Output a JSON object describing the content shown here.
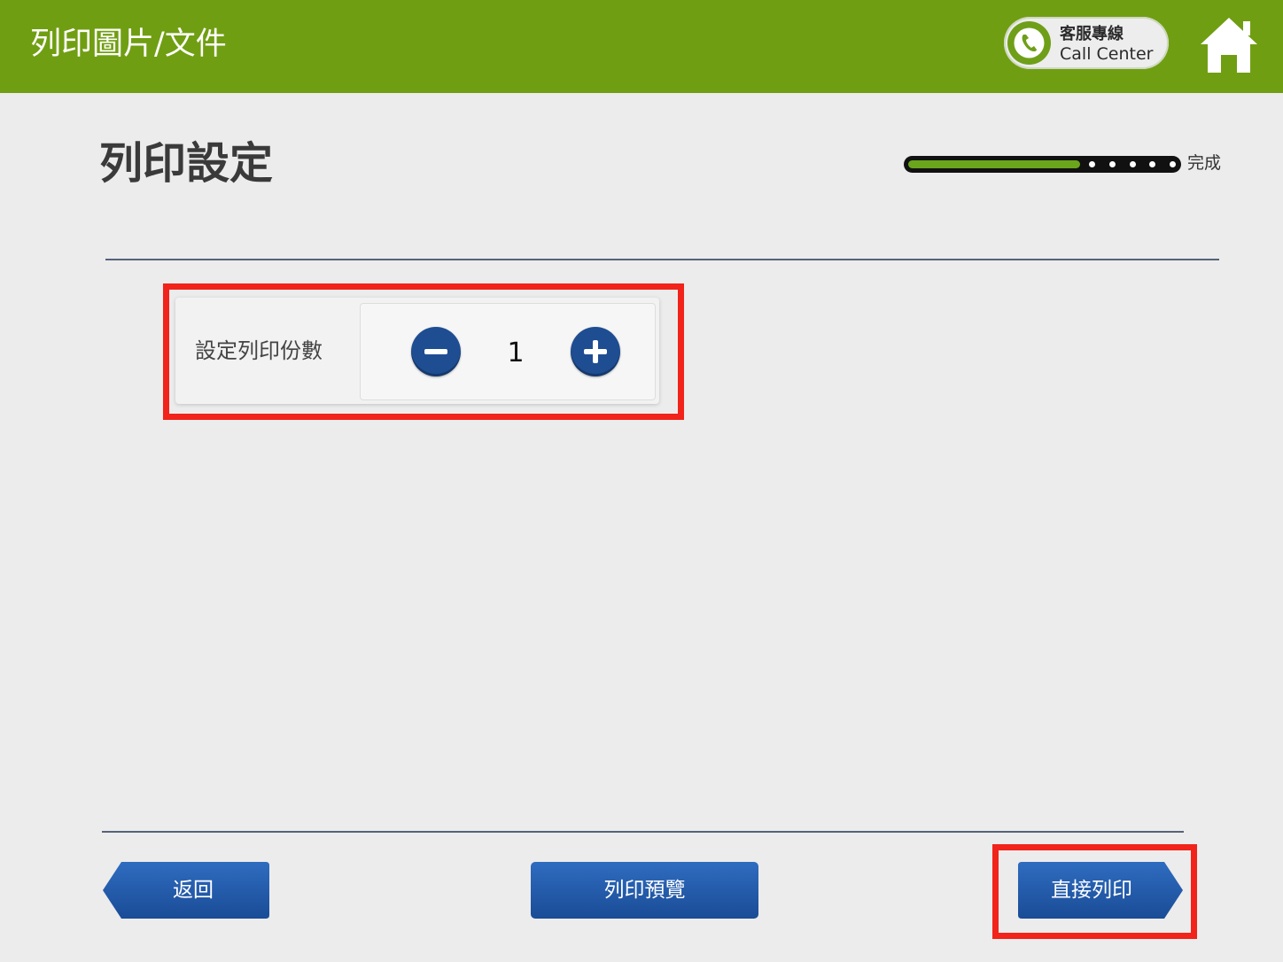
{
  "header": {
    "title": "列印圖片/文件",
    "call_center": {
      "line1": "客服專線",
      "line2": "Call Center",
      "icon": "phone-icon"
    },
    "home_icon": "home-icon"
  },
  "page": {
    "title": "列印設定"
  },
  "progress": {
    "fraction": 0.64,
    "remaining_steps": 5,
    "end_label": "完成"
  },
  "copies": {
    "label": "設定列印份數",
    "value": "1",
    "decrement_icon": "minus-icon",
    "increment_icon": "plus-icon"
  },
  "footer": {
    "back_label": "返回",
    "preview_label": "列印預覽",
    "print_label": "直接列印"
  },
  "colors": {
    "header_green": "#709e12",
    "button_blue": "#1f5bad",
    "highlight_red": "#f1231a",
    "progress_green": "#6aa51c"
  }
}
